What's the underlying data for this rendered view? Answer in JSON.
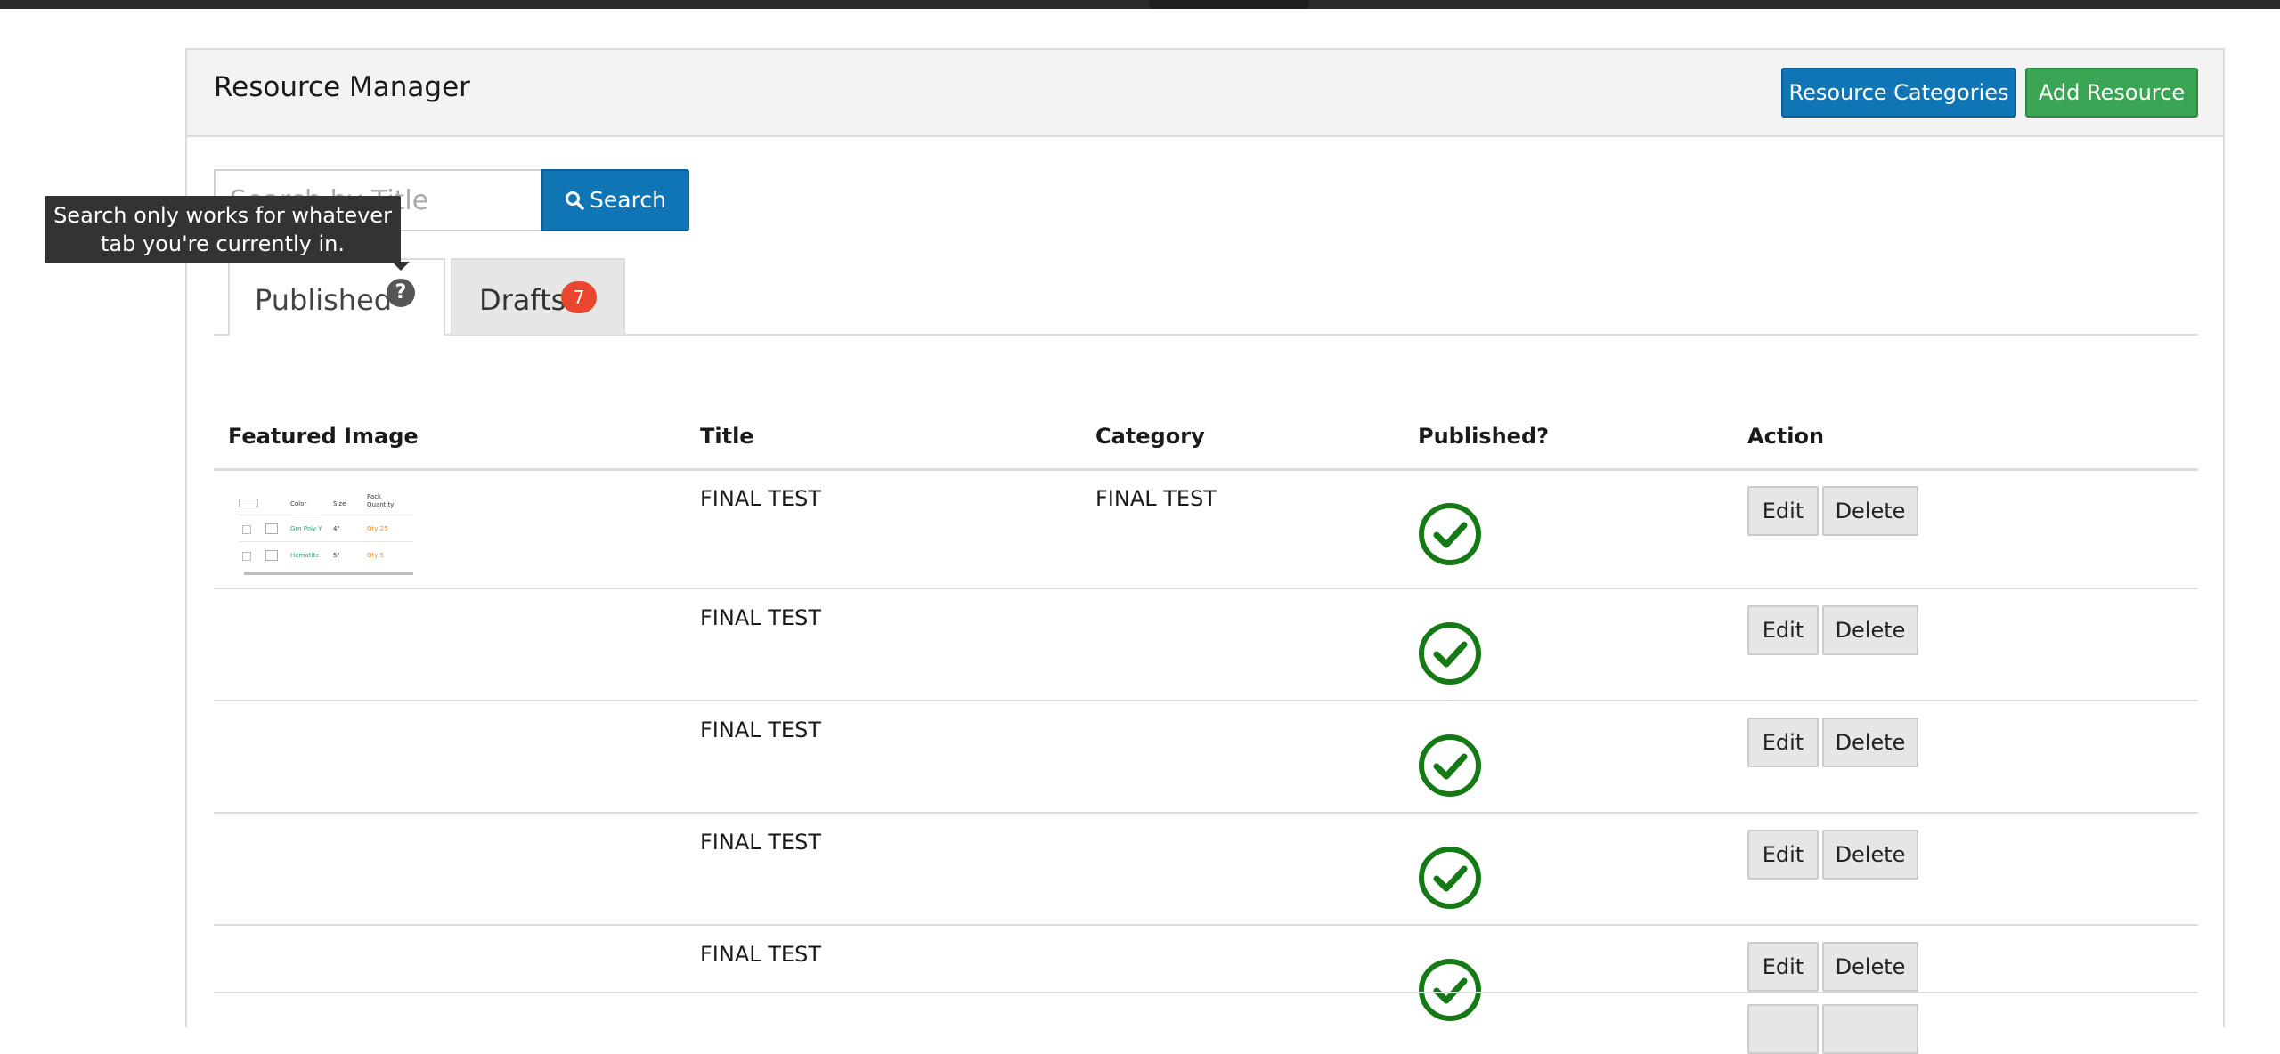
{
  "header": {
    "title": "Resource Manager",
    "categories_button": "Resource Categories",
    "add_button": "Add Resource"
  },
  "search": {
    "placeholder": "Search by Title",
    "button_label": "Search"
  },
  "tooltip": {
    "line1": "Search only works for whatever",
    "line2": "tab you're currently in."
  },
  "tabs": [
    {
      "label": "Published",
      "active": true
    },
    {
      "label": "Drafts",
      "badge": "7",
      "active": false
    }
  ],
  "table": {
    "columns": [
      "Featured Image",
      "Title",
      "Category",
      "Published?",
      "Action"
    ],
    "rows": [
      {
        "title": "FINAL TEST",
        "category": "FINAL TEST",
        "published": true,
        "has_image": true
      },
      {
        "title": "FINAL TEST",
        "category": "",
        "published": true,
        "has_image": false
      },
      {
        "title": "FINAL TEST",
        "category": "",
        "published": true,
        "has_image": false
      },
      {
        "title": "FINAL TEST",
        "category": "",
        "published": true,
        "has_image": false
      },
      {
        "title": "FINAL TEST",
        "category": "",
        "published": true,
        "has_image": false
      }
    ],
    "action_labels": {
      "edit": "Edit",
      "delete": "Delete"
    }
  },
  "thumbnail": {
    "headers": [
      "Color",
      "Size",
      "Pack Quantity"
    ],
    "rows": [
      {
        "color": "Grn Poly Y",
        "size": "4\"",
        "qty": "Qty 25"
      },
      {
        "color": "Hematite",
        "size": "5\"",
        "qty": "Qty 5"
      }
    ]
  },
  "colors": {
    "primary": "#1075b5",
    "success": "#3aa552",
    "check": "#157a16",
    "badge": "#e8462f"
  },
  "icons": {
    "search": "search-icon",
    "help": "question-circle-icon",
    "published": "check-circle-icon"
  }
}
